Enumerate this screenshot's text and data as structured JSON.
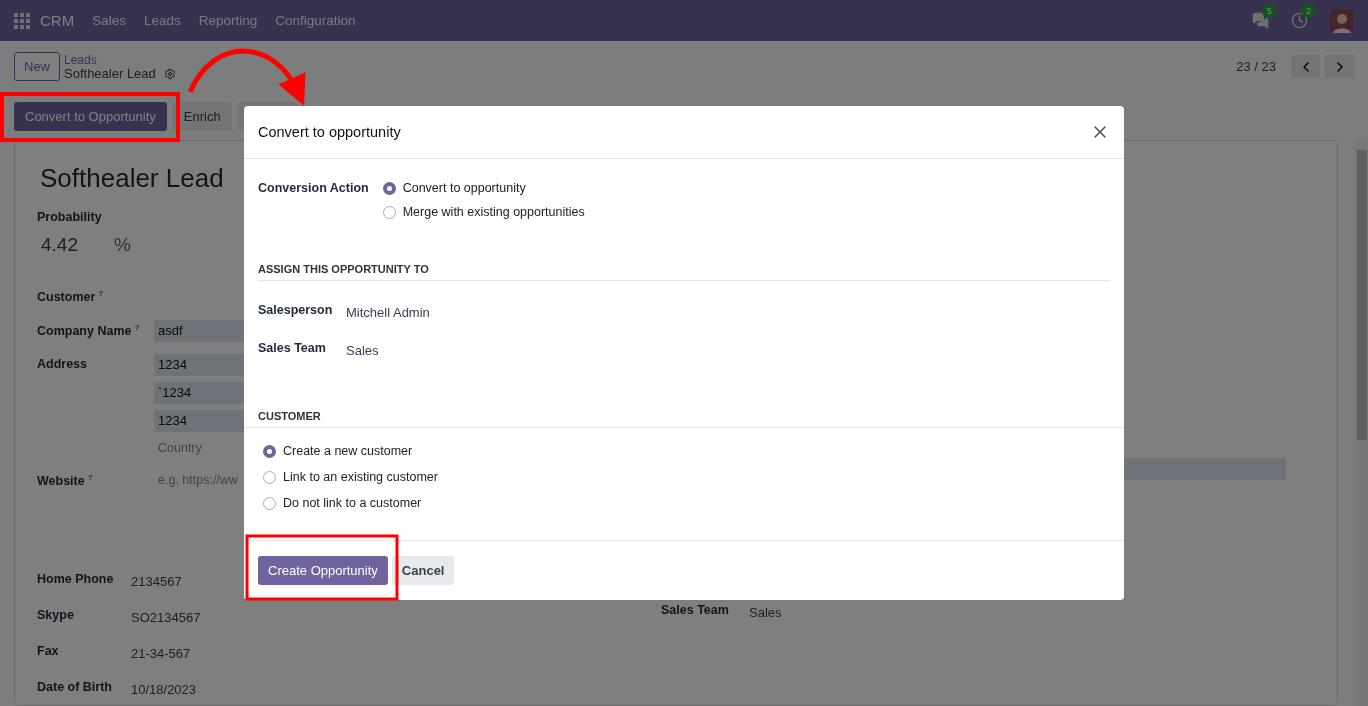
{
  "navbar": {
    "app": "CRM",
    "menu": [
      "Sales",
      "Leads",
      "Reporting",
      "Configuration"
    ],
    "chat_badge": "5",
    "activity_badge": "2"
  },
  "control_panel": {
    "new_button": "New",
    "breadcrumb_parent": "Leads",
    "breadcrumb_current": "Softhealer Lead",
    "pager": "23 / 23"
  },
  "action_buttons": [
    {
      "label": "Convert to Opportunity",
      "kind": "primary"
    },
    {
      "label": "Enrich",
      "kind": "secondary"
    }
  ],
  "form": {
    "title": "Softhealer Lead",
    "probability": {
      "label": "Probability",
      "value": "4.42",
      "unit": "%"
    },
    "fields": [
      {
        "label": "Customer",
        "help": "?"
      },
      {
        "label": "Company Name",
        "help": "?",
        "values": [
          "asdf"
        ]
      },
      {
        "label": "Address",
        "values": [
          "1234",
          "`1234",
          "1234"
        ],
        "placeholder": "Country"
      },
      {
        "label": "Website",
        "help": "?",
        "placeholder": "e.g. https://ww"
      }
    ],
    "contact_fields": [
      {
        "label": "Home Phone",
        "value": "2134567"
      },
      {
        "label": "Skype",
        "value": "SO2134567"
      },
      {
        "label": "Fax",
        "value": "21-34-567"
      },
      {
        "label": "Date of Birth",
        "value": "10/18/2023"
      }
    ],
    "right_fields": [
      {
        "label": "Sales Team",
        "value": "Sales"
      }
    ]
  },
  "dialog": {
    "title": "Convert to opportunity",
    "conversion_label": "Conversion Action",
    "conversion_options": [
      {
        "label": "Convert to opportunity",
        "selected": true
      },
      {
        "label": "Merge with existing opportunities",
        "selected": false
      }
    ],
    "assign_heading": "ASSIGN THIS OPPORTUNITY TO",
    "assign_fields": [
      {
        "label": "Salesperson",
        "value": "Mitchell Admin"
      },
      {
        "label": "Sales Team",
        "value": "Sales"
      }
    ],
    "customer_heading": "CUSTOMER",
    "customer_options": [
      {
        "label": "Create a new customer",
        "selected": true
      },
      {
        "label": "Link to an existing customer",
        "selected": false
      },
      {
        "label": "Do not link to a customer",
        "selected": false
      }
    ],
    "buttons": [
      {
        "label": "Create Opportunity",
        "kind": "primary"
      },
      {
        "label": "Cancel",
        "kind": "secondary"
      }
    ]
  }
}
